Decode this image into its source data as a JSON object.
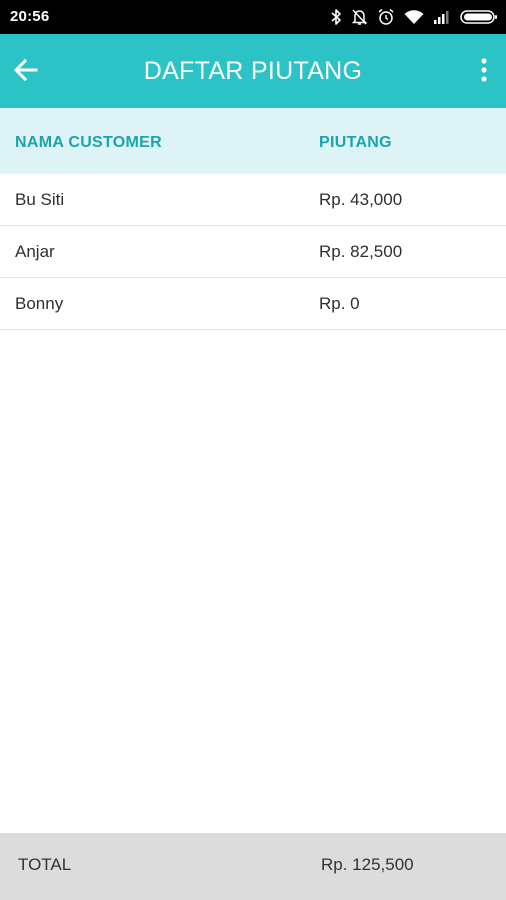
{
  "status_bar": {
    "time": "20:56",
    "icons": [
      "bluetooth-icon",
      "notifications-off-icon",
      "alarm-icon",
      "wifi-icon",
      "signal-icon",
      "battery-icon"
    ]
  },
  "app_bar": {
    "title": "DAFTAR PIUTANG",
    "back_icon": "arrow-left-icon",
    "menu_icon": "more-vertical-icon"
  },
  "table": {
    "headers": {
      "name": "NAMA CUSTOMER",
      "amount": "PIUTANG"
    },
    "rows": [
      {
        "name": "Bu Siti",
        "amount": "Rp. 43,000"
      },
      {
        "name": "Anjar",
        "amount": "Rp. 82,500"
      },
      {
        "name": "Bonny",
        "amount": "Rp. 0"
      }
    ]
  },
  "footer": {
    "label": "TOTAL",
    "value": "Rp. 125,500"
  },
  "colors": {
    "app_bar": "#2bc3c6",
    "header_bg": "#ddf3f5",
    "header_text": "#1aa5ad",
    "footer_bg": "#dcdcdc"
  }
}
